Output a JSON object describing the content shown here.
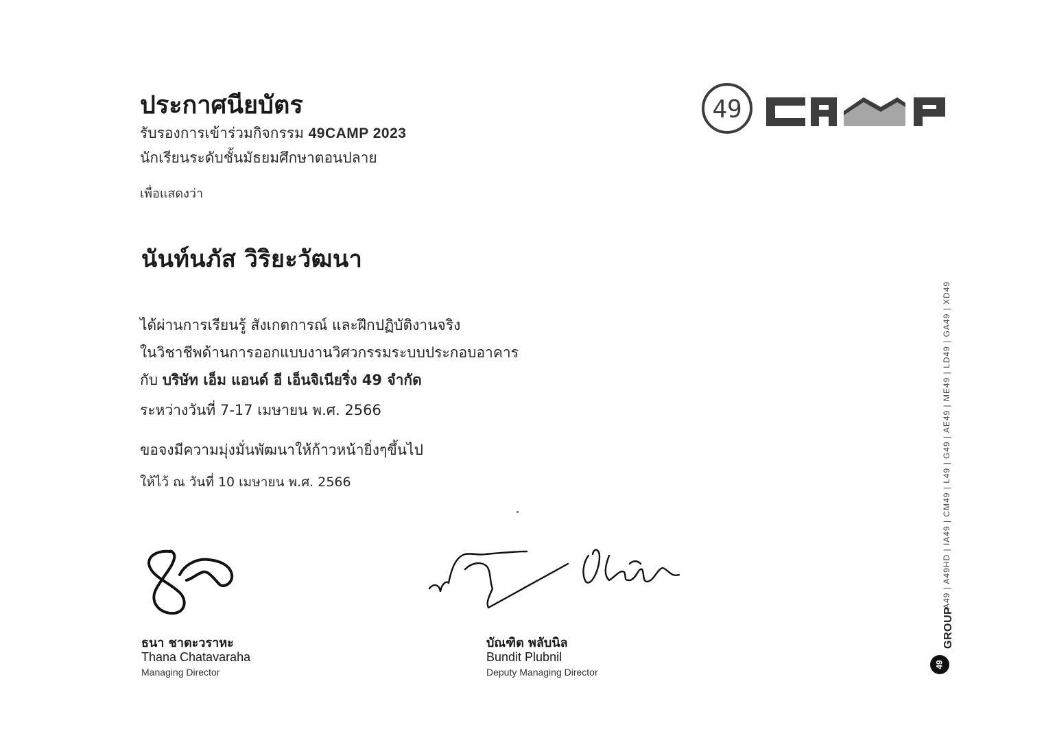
{
  "certificate": {
    "title": "ประกาศนียบัตร",
    "subtitle_prefix": "รับรองการเข้าร่วมกิจกรรม",
    "subtitle_event": "49CAMP 2023",
    "subtitle_line2": "นักเรียนระดับชั้นมัธยมศึกษาตอนปลาย",
    "intro": "เพื่อแสดงว่า",
    "recipient_name": "นันท์นภัส วิริยะวัฒนา",
    "body": {
      "line1": "ได้ผ่านการเรียนรู้ สังเกตการณ์ และฝึกปฏิบัติงานจริง",
      "line2": "ในวิชาชีพด้านการออกแบบงานวิศวกรรมระบบประกอบอาคาร",
      "line3_prefix": "กับ",
      "line3_company": "บริษัท เอ็ม แอนด์ อี เอ็นจิเนียริ่ง 49 จำกัด",
      "line4": "ระหว่างวันที่ 7-17 เมษายน พ.ศ. 2566",
      "line5": "ขอจงมีความมุ่งมั่นพัฒนาให้ก้าวหน้ายิ่งๆขึ้นไป",
      "line6": "ให้ไว้ ณ วันที่ 10 เมษายน พ.ศ. 2566"
    }
  },
  "logo": {
    "badge_number": "49",
    "wordmark": "CAMP"
  },
  "signatories": [
    {
      "name_th": "ธนา ชาตะวราหะ",
      "name_en": "Thana Chatavaraha",
      "role": "Managing Director"
    },
    {
      "name_th": "บัณฑิต พลับนิล",
      "name_en": "Bundit Plubnil",
      "role": "Deputy Managing Director"
    }
  ],
  "sidebar": {
    "badge": "49",
    "group_word": "GROUP",
    "companies": "A49 | A49HD | IA49 | CM49 | L49 | G49 | AE49 | ME49 | LD49 | GA49 | XD49"
  },
  "colors": {
    "logo_dark": "#3c3c3c",
    "logo_roof": "#a6a6a6",
    "text": "#1e1e1e"
  }
}
